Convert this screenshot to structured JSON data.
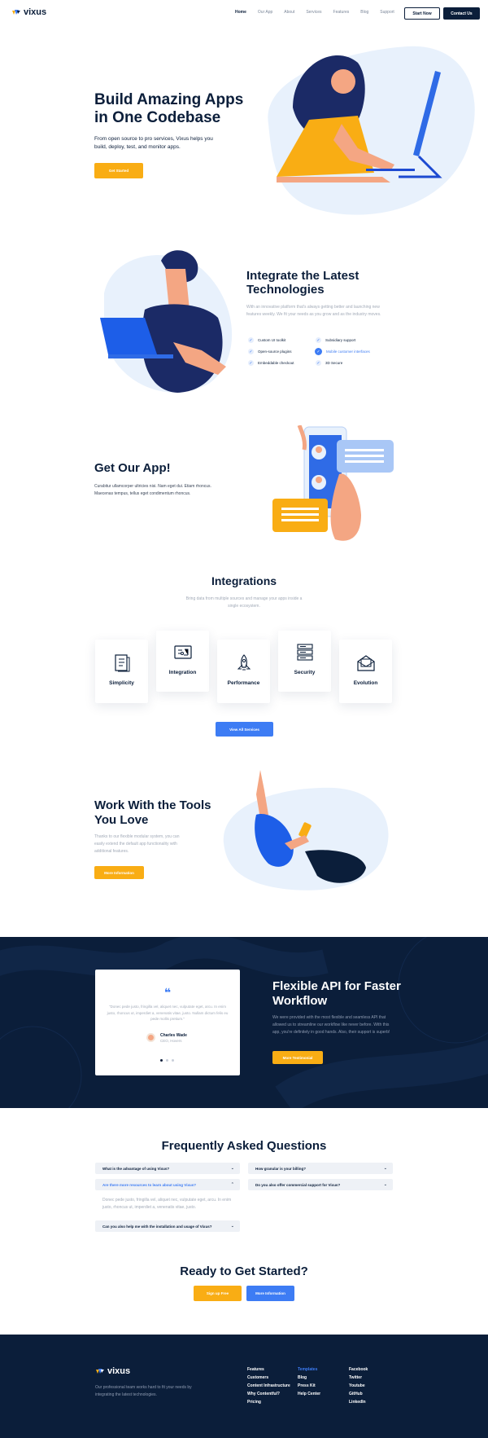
{
  "nav": {
    "brand": "vixus",
    "links": [
      "Home",
      "Our App",
      "About",
      "Services",
      "Features",
      "Blog",
      "Support"
    ],
    "start_now": "Start Now",
    "contact": "Contact Us"
  },
  "hero": {
    "title": "Build Amazing Apps in One Codebase",
    "desc": "From open source to pro services, Vixus helps you build, deploy, test, and monitor apps.",
    "cta": "Get Started"
  },
  "integrate": {
    "title": "Integrate the Latest Technologies",
    "desc": "With an innovative platform that's always getting better and launching new features weekly. We fit your needs as you grow and as the industry moves.",
    "features": [
      "Custom UI toolkit",
      "Subsidiary support",
      "Open-source plugins",
      "Mobile customer interfaces",
      "Embeddable checkout",
      "3D Secure"
    ]
  },
  "app": {
    "title": "Get Our App!",
    "desc": "Curabitur ullamcorper ultricies nisi. Nam eget dui. Etiam rhoncus. Maecenas tempus, tellus eget condimentum rhoncus."
  },
  "integrations": {
    "title": "Integrations",
    "desc": "Bring data from multiple sources and manage your apps inside a single ecosystem.",
    "cards": [
      "Simplicity",
      "Integration",
      "Performance",
      "Security",
      "Evolution"
    ],
    "cta": "View All Services"
  },
  "tools": {
    "title": "Work With the Tools You Love",
    "desc": "Thanks to our flexible modular system, you can easily extend the default app functionality with additional features.",
    "cta": "More Information"
  },
  "api": {
    "quote": "\"Donec pede justo, fringilla vel, aliquet nec, vulputate eget, arcu. In enim justo, rhoncus ut, imperdiet a, venenatis vitae, justo. Nullam dictum felis eu pede mollis pretium.\"",
    "author": "Charles Wade",
    "role": "CEO, Hovers",
    "title": "Flexible API for Faster Workflow",
    "desc": "We were provided with the most flexible and seamless API that allowed us to streamline our workflow like never before. With this app, you're definitely in good hands. Also, their support is superb!",
    "cta": "More Testimonial"
  },
  "faq": {
    "title": "Frequently Asked Questions",
    "left": [
      "What is the advantage of using Vixus?",
      "Are there more resources to learn about using Vixus?",
      "Can you also help me with the installation and usage of Vixus?"
    ],
    "answer": "Donec pede justo, fringilla vel, aliquet nec, vulputate eget, arcu. In enim justo, rhoncus ut, imperdiet a, venenatis vitae, justo.",
    "right": [
      "How granular is your billing?",
      "Do you also offer commercial support for Vixus?"
    ]
  },
  "ready": {
    "title": "Ready to Get Started?",
    "signup": "Sign up Free",
    "more": "More Information"
  },
  "footer": {
    "brand": "vixus",
    "desc": "Our professional team works hard to fit your needs by integrating the latest technologies.",
    "col1": [
      "Features",
      "Customers",
      "Content Infrastructure",
      "Why Contentful?",
      "Pricing"
    ],
    "col2": [
      "Templates",
      "Blog",
      "Press Kit",
      "Help Center"
    ],
    "col3": [
      "Facebook",
      "Twitter",
      "Youtube",
      "GitHub",
      "LinkedIn"
    ]
  },
  "colors": {
    "navy": "#0b1e3a",
    "yellow": "#f9ad14",
    "blue": "#3d7cf4",
    "light_blue": "#e8f1fc"
  }
}
